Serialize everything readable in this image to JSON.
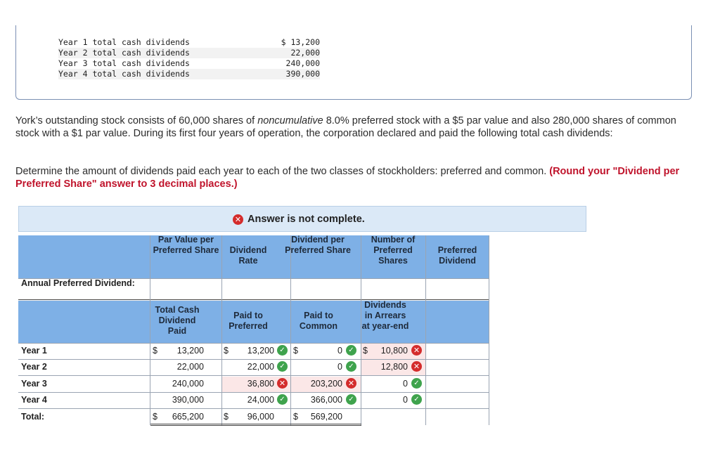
{
  "given": {
    "rows": [
      {
        "label": "Year 1 total cash dividends",
        "value": "$ 13,200"
      },
      {
        "label": "Year 2 total cash dividends",
        "value": "22,000"
      },
      {
        "label": "Year 3 total cash dividends",
        "value": "240,000"
      },
      {
        "label": "Year 4 total cash dividends",
        "value": "390,000"
      }
    ]
  },
  "problem": {
    "p1_a": "York’s outstanding stock consists of 60,000 shares of ",
    "p1_em": "noncumulative",
    "p1_b": " 8.0% preferred stock with a $5 par value and also 280,000 shares of common stock with a $1 par value. During its first four years of operation, the corporation declared and paid the following total cash dividends:",
    "instruction": "Determine the amount of dividends paid each year to each of the two classes of stockholders: preferred and common.",
    "round_note": "(Round your \"Dividend per Preferred Share\" answer to 3 decimal places.)"
  },
  "banner": {
    "text": "Answer is not complete.",
    "icon": "x-circle-icon"
  },
  "table1": {
    "headers": [
      "Par Value per Preferred Share",
      "Dividend Rate",
      "Dividend per Preferred Share",
      "Number of Preferred Shares",
      "Preferred Dividend"
    ],
    "row_label": "Annual Preferred Dividend:"
  },
  "table2": {
    "headers": [
      "Total Cash Dividend Paid",
      "Paid to Preferred",
      "Paid to Common",
      "Dividends in Arrears at year-end"
    ],
    "rows": [
      {
        "label": "Year 1",
        "total": "13,200",
        "preferred": "13,200",
        "common": "0",
        "arrears": "10,800",
        "preferred_status": "correct",
        "common_status": "correct",
        "arrears_status": "incorrect"
      },
      {
        "label": "Year 2",
        "total": "22,000",
        "preferred": "22,000",
        "common": "0",
        "arrears": "12,800",
        "preferred_status": "correct",
        "common_status": "correct",
        "arrears_status": "incorrect"
      },
      {
        "label": "Year 3",
        "total": "240,000",
        "preferred": "36,800",
        "common": "203,200",
        "arrears": "0",
        "preferred_status": "incorrect",
        "common_status": "incorrect",
        "arrears_status": "correct"
      },
      {
        "label": "Year 4",
        "total": "390,000",
        "preferred": "24,000",
        "common": "366,000",
        "arrears": "0",
        "preferred_status": "correct",
        "common_status": "correct",
        "arrears_status": "correct"
      }
    ],
    "total_row": {
      "label": "Total:",
      "total": "665,200",
      "preferred": "96,000",
      "common": "569,200"
    },
    "currency": "$"
  },
  "colors": {
    "header_blue": "#7eb0e6",
    "banner_blue": "#dbe9f7",
    "incorrect_red": "#d42c2c",
    "correct_green": "#3fa34d",
    "round_red": "#c0142c"
  }
}
